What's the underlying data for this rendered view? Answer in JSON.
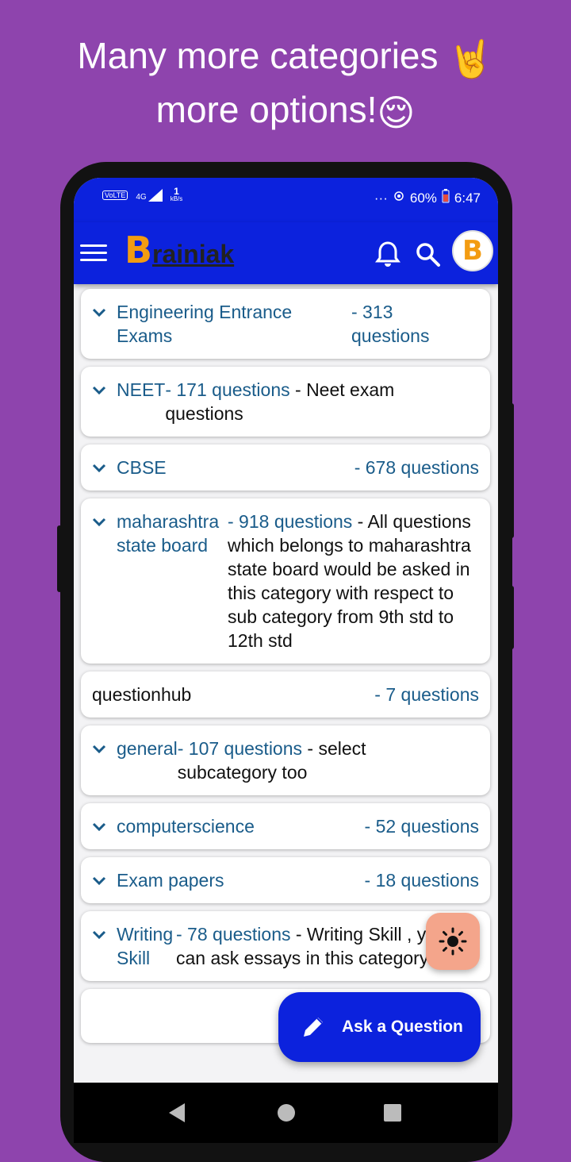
{
  "promo": {
    "line1": "Many more categories",
    "line2": "more options!",
    "emoji1": "🤘",
    "emoji2": "😌"
  },
  "status_bar": {
    "network_left": "VoLTE",
    "network_type": "4G",
    "data_speed": "1",
    "data_unit": "kB/s",
    "dots": "···",
    "battery": "60%",
    "time": "6:47"
  },
  "app_bar": {
    "logo_letter": "B",
    "logo_text": "rainiak",
    "avatar_letter": "B"
  },
  "categories": [
    {
      "name": "Engineering Entrance Exams",
      "count": "- 313 questions",
      "description": "",
      "has_chevron": true
    },
    {
      "name": "NEET",
      "count": "- 171 questions",
      "description": " - Neet exam questions",
      "has_chevron": true
    },
    {
      "name": "CBSE",
      "count": "- 678 questions",
      "description": "",
      "has_chevron": true
    },
    {
      "name": "maharashtra state board",
      "count": "- 918 questions",
      "description": " - All questions which belongs to maharashtra state board would be asked in this category with respect to sub category from 9th std to 12th std",
      "has_chevron": true
    },
    {
      "name": "questionhub",
      "count": "- 7 questions",
      "description": "",
      "has_chevron": false
    },
    {
      "name": "general",
      "count": "- 107 questions",
      "description": " - select subcategory too",
      "has_chevron": true
    },
    {
      "name": "computerscience",
      "count": "- 52 questions",
      "description": "",
      "has_chevron": true
    },
    {
      "name": "Exam papers",
      "count": "- 18 questions",
      "description": "",
      "has_chevron": true
    },
    {
      "name": "Writing Skill",
      "count": "- 78 questions",
      "description": " - Writing Skill , you can ask essays in this category",
      "has_chevron": true
    }
  ],
  "fab": {
    "ask_label": "Ask a Question"
  },
  "colors": {
    "background": "#8e44ad",
    "app_bar": "#0c22dd",
    "link_text": "#1a5c8a",
    "theme_fab": "#f4a58b"
  }
}
